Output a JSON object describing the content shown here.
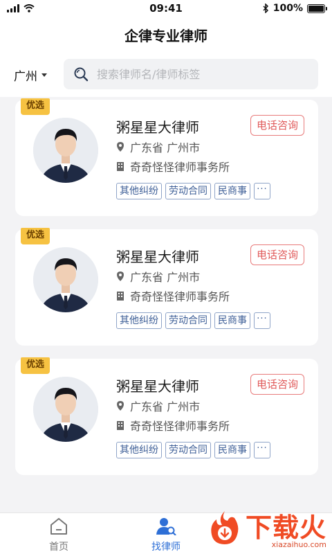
{
  "status_bar": {
    "time": "09:41",
    "battery": "100%",
    "battery_level": 1.0
  },
  "header": {
    "title": "企律专业律师"
  },
  "filter": {
    "city": "广州",
    "search_placeholder": "搜索律师名/律师标签"
  },
  "lawyers": [
    {
      "badge": "优选",
      "name": "粥星星大律师",
      "action": "电话咨询",
      "location": "广东省 广州市",
      "firm": "奇奇怪怪律师事务所",
      "tags": [
        "其他纠纷",
        "劳动合同",
        "民商事"
      ],
      "more": "···"
    },
    {
      "badge": "优选",
      "name": "粥星星大律师",
      "action": "电话咨询",
      "location": "广东省 广州市",
      "firm": "奇奇怪怪律师事务所",
      "tags": [
        "其他纠纷",
        "劳动合同",
        "民商事"
      ],
      "more": "···"
    },
    {
      "badge": "优选",
      "name": "粥星星大律师",
      "action": "电话咨询",
      "location": "广东省 广州市",
      "firm": "奇奇怪怪律师事务所",
      "tags": [
        "其他纠纷",
        "劳动合同",
        "民商事"
      ],
      "more": "···"
    }
  ],
  "tabbar": {
    "items": [
      {
        "label": "首页",
        "icon": "home-icon",
        "active": false
      },
      {
        "label": "找律师",
        "icon": "find-lawyer-icon",
        "active": true
      }
    ],
    "active_color": "#2e6fd6",
    "inactive_color": "#777777"
  },
  "watermark": {
    "text": "下载火",
    "sub": "xiazaihuo.com",
    "color": "#f04b24"
  }
}
